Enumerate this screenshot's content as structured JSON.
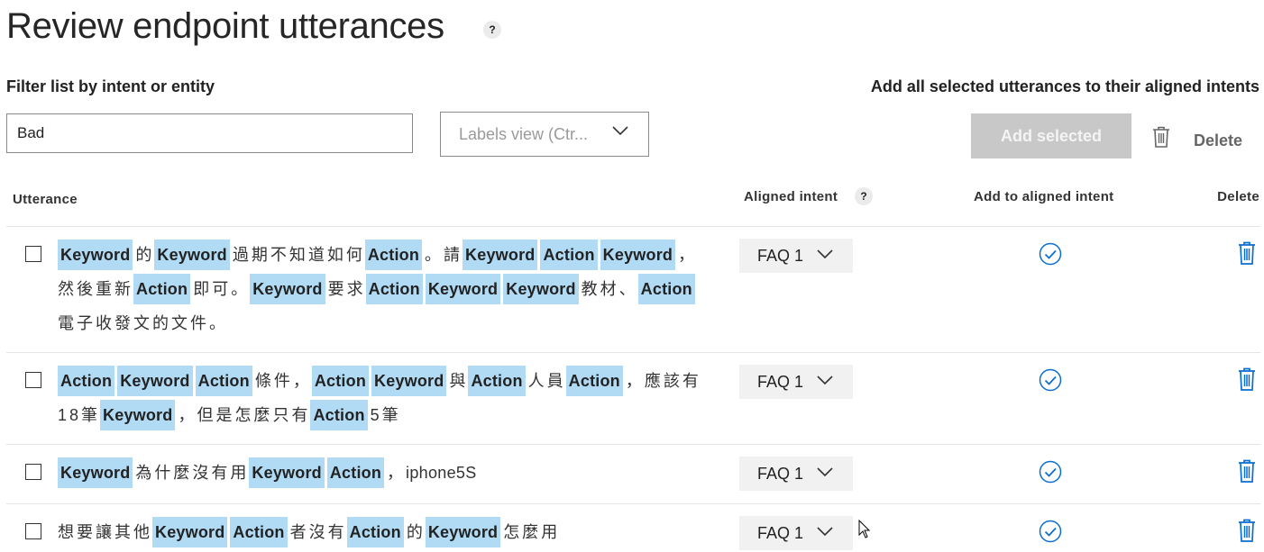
{
  "title": "Review endpoint utterances",
  "title_help": "?",
  "filter": {
    "label": "Filter list by intent or entity",
    "value": "Bad"
  },
  "labels_view": {
    "label": "Labels view (Ctr..."
  },
  "actions": {
    "add_all_label": "Add all selected utterances to their aligned intents",
    "add_selected": "Add selected",
    "delete": "Delete"
  },
  "columns": {
    "utterance": "Utterance",
    "aligned_intent": "Aligned intent",
    "aligned_help": "?",
    "add_to_aligned": "Add to aligned intent",
    "delete": "Delete"
  },
  "colors": {
    "chip": "#b1dbf4",
    "accent": "#0a6ed1",
    "disabled_button": "#c8c8c8"
  },
  "rows": [
    {
      "intent": "FAQ 1",
      "segments": [
        {
          "t": "Keyword",
          "chip": true
        },
        {
          "t": "的"
        },
        {
          "t": "Keyword",
          "chip": true
        },
        {
          "t": "過期不知道如何"
        },
        {
          "t": "Action",
          "chip": true
        },
        {
          "t": "。請"
        },
        {
          "t": "Keyword",
          "chip": true
        },
        {
          "t": "Action",
          "chip": true
        },
        {
          "t": "Keyword",
          "chip": true
        },
        {
          "t": "，然後重新"
        },
        {
          "t": "Action",
          "chip": true
        },
        {
          "t": "即可。"
        },
        {
          "t": "Keyword",
          "chip": true
        },
        {
          "t": "要求"
        },
        {
          "t": "Action",
          "chip": true
        },
        {
          "t": "Keyword",
          "chip": true
        },
        {
          "t": "Keyword",
          "chip": true
        },
        {
          "t": "教材、"
        },
        {
          "t": "Action",
          "chip": true
        },
        {
          "t": "電子收發文的文件。"
        }
      ]
    },
    {
      "intent": "FAQ 1",
      "segments": [
        {
          "t": "Action",
          "chip": true
        },
        {
          "t": "Keyword",
          "chip": true
        },
        {
          "t": "Action",
          "chip": true
        },
        {
          "t": "條件，"
        },
        {
          "t": "Action",
          "chip": true
        },
        {
          "t": "Keyword",
          "chip": true
        },
        {
          "t": "與"
        },
        {
          "t": "Action",
          "chip": true
        },
        {
          "t": "人員"
        },
        {
          "t": "Action",
          "chip": true
        },
        {
          "t": "，應"
        },
        {
          "t": "該有18筆"
        },
        {
          "t": "Keyword",
          "chip": true
        },
        {
          "t": "，但是怎麼只有"
        },
        {
          "t": "Action",
          "chip": true
        },
        {
          "t": "5筆"
        }
      ]
    },
    {
      "intent": "FAQ 1",
      "segments": [
        {
          "t": "Keyword",
          "chip": true
        },
        {
          "t": "為什麼沒有用"
        },
        {
          "t": "Keyword",
          "chip": true
        },
        {
          "t": "Action",
          "chip": true
        },
        {
          "t": "，"
        },
        {
          "t": "iphone5S",
          "ascii": true
        }
      ]
    },
    {
      "intent": "FAQ 1",
      "segments": [
        {
          "t": "想要讓其他"
        },
        {
          "t": "Keyword",
          "chip": true
        },
        {
          "t": "Action",
          "chip": true
        },
        {
          "t": "者沒有"
        },
        {
          "t": "Action",
          "chip": true
        },
        {
          "t": "的"
        },
        {
          "t": "Keyword",
          "chip": true
        },
        {
          "t": "怎麼用"
        }
      ]
    }
  ]
}
